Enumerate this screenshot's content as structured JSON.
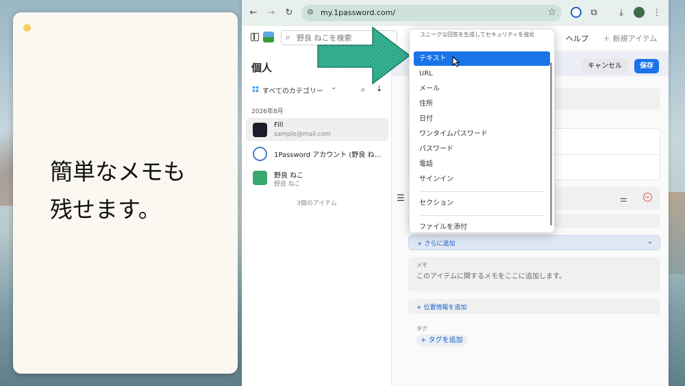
{
  "note": {
    "lines": [
      "簡単なメモも",
      "残せます。"
    ]
  },
  "browser": {
    "url": "my.1password.com/",
    "nav_icons": [
      "back-icon",
      "forward-icon",
      "reload-icon"
    ]
  },
  "app_header": {
    "search_placeholder": "野良 ねこを検索",
    "help": "ヘルプ",
    "new_item": "＋ 新規アイテム"
  },
  "list": {
    "vault_title": "個人",
    "category": "すべてのカテゴリー",
    "month": "2026年8月",
    "items": [
      {
        "title": "Fill",
        "subtitle": "sample@mail.com",
        "icon": "fill-logo-icon"
      },
      {
        "title": "1Password アカウント (野良 ね…",
        "subtitle": "",
        "icon": "onepassword-icon"
      },
      {
        "title": "野良 ねこ",
        "subtitle": "野良 ねこ",
        "icon": "identity-card-icon"
      }
    ],
    "count": "3個のアイテム"
  },
  "editor": {
    "cancel": "キャンセル",
    "save": "保存",
    "add_more": "+ さらに追加",
    "memo_label": "メモ",
    "memo_placeholder": "このアイテムに関するメモをここに追加します。",
    "add_location": "+ 位置情報を追加",
    "tags_label": "タグ",
    "add_tag": "+ タグを追加"
  },
  "menu": {
    "hint": "ユニークな回答を生成してセキュリティを強化",
    "items": [
      "テキスト",
      "URL",
      "メール",
      "住所",
      "日付",
      "ワンタイムパスワード",
      "パスワード",
      "電話",
      "サインイン"
    ],
    "section": "セクション",
    "attach": "ファイルを添付",
    "active_index": 0
  },
  "colors": {
    "accent": "#1a73e8",
    "arrow": "#2fa58c",
    "note_bg": "#fbf8f1"
  }
}
